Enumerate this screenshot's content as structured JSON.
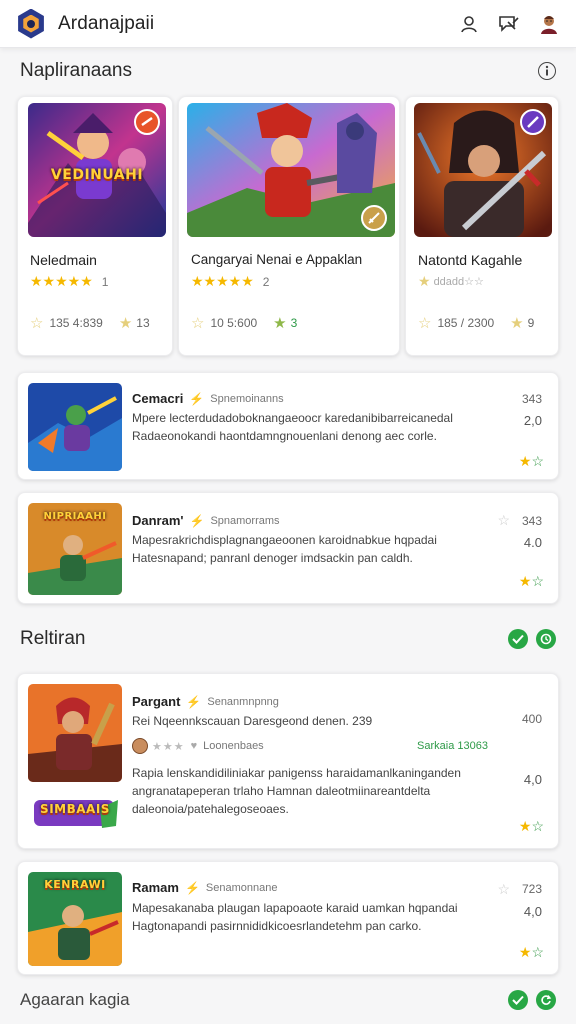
{
  "header": {
    "app_title": "Ardanajpaii",
    "actions": [
      {
        "icon": "user-icon"
      },
      {
        "icon": "chat-icon"
      },
      {
        "icon": "avatar-icon"
      }
    ]
  },
  "featured": {
    "title": "Napliranaans",
    "info_icon": "info-icon",
    "cards": [
      {
        "name": "Neledmain",
        "rating_count": "1",
        "stars": 5,
        "meta_a": "135 4:839",
        "meta_b": "13",
        "banner": "VEDINUAHI"
      },
      {
        "name": "Cangaryai Nenai e Appaklan",
        "rating_count": "2",
        "stars": 5,
        "meta_a": "10 5:600",
        "meta_b": "3",
        "banner": ""
      },
      {
        "name": "Natontd Kagahle",
        "rating_count": "",
        "stars": 0,
        "meta_a": "185 / 2300",
        "meta_b": "9",
        "banner": ""
      }
    ]
  },
  "list_one": [
    {
      "title": "Cemacri",
      "sub": "Spnemoinanns",
      "desc": "Mpere lecterdudadoboknangaeoocr karedanibibarreicanedal Radaeonokandi haontdamngnouenlani denong aec corle.",
      "num": "343",
      "rating": "2,0"
    },
    {
      "title": "Danram'",
      "sub": "Spnamorrams",
      "desc": "Mapesrakrichdisplagnangaeoonen karoidnabkue hqpadai Hatesnapand; panranl denoger imdsackin pan caldh.",
      "num": "343",
      "rating": "4.0",
      "banner": "NIPRIAAHI"
    }
  ],
  "recent": {
    "title": "Reltiran",
    "items": [
      {
        "title": "Pargant",
        "sub": "Senanmnpnng",
        "line1": "Rei Nqeennkscauan Daresgeond denen. 239",
        "avatar_label": "Loonenbaes",
        "green": "Sarkaia 13063",
        "desc": "Rapia lenskandidiliniakar panigenss haraidamanlkaninganden angranatapeperan trlaho Hamnan daleotmiinareantdelta daleonoia/patehalegoseoaes.",
        "num": "400",
        "rating": "4,0",
        "logo": "SIMBAAIS"
      },
      {
        "title": "Ramam",
        "sub": "Senamonnane",
        "desc": "Mapesakanaba plaugan lapapoaote karaid uamkan hqpandai Hagtonapandi pasirnnididkicoesrlandetehm pan carko.",
        "num": "723",
        "rating": "4,0",
        "banner": "KENRAWI"
      }
    ]
  },
  "footer_section": {
    "title": "Agaaran kagia"
  },
  "colors": {
    "accent_green": "#28a745",
    "star": "#f5b800",
    "brand": "#2a3a8c"
  }
}
